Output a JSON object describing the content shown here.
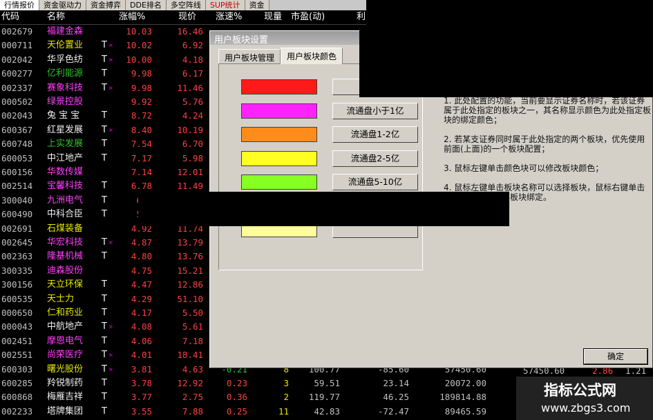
{
  "tabs": [
    {
      "label": "行情报价",
      "selected": true
    },
    {
      "label": "资金驱动力"
    },
    {
      "label": "资金搏弈"
    },
    {
      "label": "DDE排名"
    },
    {
      "label": "多空阵线"
    },
    {
      "label": "SUP统计",
      "red": true
    },
    {
      "label": "资金"
    }
  ],
  "header": {
    "code": "代码",
    "name": "名称",
    "chg": "涨幅%",
    "price": "现价",
    "speed": "涨速%",
    "vol": "现量",
    "pe": "市盈(动)",
    "more": "利"
  },
  "colors": {
    "name_yellow": "#e8e800",
    "name_magenta": "#ff40ff",
    "name_green": "#30c030",
    "name_white": "#f0f0f0",
    "up_red": "#ff4040",
    "down_green": "#30c030"
  },
  "rows": [
    {
      "code": "002679",
      "name": "福建金森",
      "t": "",
      "star": "",
      "chg": "10.03",
      "price": "16.46",
      "nc": "magenta"
    },
    {
      "code": "000711",
      "name": "天伦置业",
      "t": "T",
      "star": "×",
      "chg": "10.02",
      "price": "6.92",
      "nc": "yellow"
    },
    {
      "code": "002042",
      "name": "华孚色纺",
      "t": "T",
      "star": "×",
      "chg": "10.00",
      "price": "4.18",
      "nc": "white"
    },
    {
      "code": "600277",
      "name": "亿利能源",
      "t": "T",
      "star": "",
      "chg": "9.98",
      "price": "6.17",
      "nc": "green"
    },
    {
      "code": "002337",
      "name": "赛象科技",
      "t": "T",
      "star": "×",
      "chg": "9.98",
      "price": "11.46",
      "nc": "magenta"
    },
    {
      "code": "000502",
      "name": "绿景控股",
      "t": "",
      "star": "",
      "chg": "9.92",
      "price": "5.76",
      "nc": "magenta"
    },
    {
      "code": "002043",
      "name": "兔 宝 宝",
      "t": "T",
      "star": "",
      "chg": "8.72",
      "price": "4.24",
      "nc": "white"
    },
    {
      "code": "600367",
      "name": "红星发展",
      "t": "T",
      "star": "×",
      "chg": "8.40",
      "price": "10.19",
      "nc": "white"
    },
    {
      "code": "600748",
      "name": "上实发展",
      "t": "T",
      "star": "",
      "chg": "7.54",
      "price": "6.70",
      "nc": "green"
    },
    {
      "code": "600053",
      "name": "中江地产",
      "t": "T",
      "star": "",
      "chg": "7.17",
      "price": "5.98",
      "nc": "white"
    },
    {
      "code": "600156",
      "name": "华数传媒",
      "t": "",
      "star": "",
      "chg": "7.14",
      "price": "12.01",
      "nc": "magenta"
    },
    {
      "code": "002514",
      "name": "宝馨科技",
      "t": "T",
      "star": "",
      "chg": "6.78",
      "price": "11.49",
      "nc": "magenta"
    },
    {
      "code": "300040",
      "name": "九洲电气",
      "t": "T",
      "star": "",
      "chg": "6.2",
      "price": "",
      "nc": "magenta"
    },
    {
      "code": "600490",
      "name": "中科合臣",
      "t": "T",
      "star": "",
      "chg": "5.8",
      "price": "",
      "nc": "white"
    },
    {
      "code": "002691",
      "name": "石煤装备",
      "t": "",
      "star": "",
      "chg": "4.92",
      "price": "11.74",
      "nc": "yellow"
    },
    {
      "code": "002645",
      "name": "华宏科技",
      "t": "T",
      "star": "×",
      "chg": "4.87",
      "price": "13.79",
      "nc": "magenta"
    },
    {
      "code": "002363",
      "name": "隆基机械",
      "t": "T",
      "star": "",
      "chg": "4.80",
      "price": "13.76",
      "nc": "magenta"
    },
    {
      "code": "300335",
      "name": "迪森股份",
      "t": "",
      "star": "",
      "chg": "4.75",
      "price": "15.21",
      "nc": "magenta"
    },
    {
      "code": "300156",
      "name": "天立环保",
      "t": "T",
      "star": "",
      "chg": "4.47",
      "price": "12.86",
      "nc": "yellow"
    },
    {
      "code": "600535",
      "name": "天士力",
      "t": "T",
      "star": "",
      "chg": "4.29",
      "price": "51.10",
      "nc": "yellow"
    },
    {
      "code": "000650",
      "name": "仁和药业",
      "t": "T",
      "star": "",
      "chg": "4.17",
      "price": "5.50",
      "nc": "yellow"
    },
    {
      "code": "000043",
      "name": "中航地产",
      "t": "T",
      "star": "×",
      "chg": "4.08",
      "price": "5.61",
      "nc": "white"
    },
    {
      "code": "002451",
      "name": "摩恩电气",
      "t": "T",
      "star": "",
      "chg": "4.06",
      "price": "7.18",
      "nc": "magenta"
    },
    {
      "code": "002551",
      "name": "尚荣医疗",
      "t": "T",
      "star": "×",
      "chg": "4.01",
      "price": "18.41",
      "nc": "magenta"
    },
    {
      "code": "600303",
      "name": "曙光股份",
      "t": "T",
      "star": "×",
      "chg": "3.81",
      "price": "4.63",
      "speed": "-0.21",
      "vol": "8",
      "pe": "100.77",
      "f1": "-85.60",
      "f2": "57450.60",
      "nc": "yellow"
    },
    {
      "code": "600285",
      "name": "羚锐制药",
      "t": "T",
      "star": "",
      "chg": "3.78",
      "price": "12.92",
      "speed": "0.23",
      "vol": "3",
      "pe": "59.51",
      "f1": "23.14",
      "f2": "20072.00",
      "nc": "white"
    },
    {
      "code": "600868",
      "name": "梅雁吉祥",
      "t": "T",
      "star": "",
      "chg": "3.77",
      "price": "2.75",
      "speed": "0.36",
      "vol": "2",
      "pe": "119.77",
      "f1": "46.25",
      "f2": "189814.88",
      "nc": "white"
    },
    {
      "code": "002233",
      "name": "塔牌集团",
      "t": "T",
      "star": "",
      "chg": "3.55",
      "price": "7.88",
      "speed": "0.25",
      "vol": "11",
      "pe": "42.83",
      "f1": "-72.47",
      "f2": "89465.59",
      "nc": "white"
    }
  ],
  "dialog": {
    "title": "用户板块设置",
    "tabs": [
      "用户板块管理",
      "用户板块颜色"
    ],
    "colors": [
      {
        "swatch": "#ff1a1a",
        "label": "自选"
      },
      {
        "swatch": "#ff22ff",
        "label": "流通盘小于1亿"
      },
      {
        "swatch": "#ff8c1a",
        "label": "流通盘1-2亿"
      },
      {
        "swatch": "#ffff22",
        "label": "流通盘2-5亿"
      },
      {
        "swatch": "#88ff22",
        "label": "流通盘5-10亿"
      },
      {
        "swatch": "#ffffff",
        "label": ""
      },
      {
        "swatch": "#ffff99",
        "label": ""
      }
    ],
    "help": [
      "1. 此处配置的功能，当前要显示证券名称时，若该证券属于此处指定的板块之一，其名称显示颜色为此处指定板块的绑定颜色；",
      "2. 若某支证券同时属于此处指定的两个板块，优先使用前面(上面)的一个板块配置；",
      "3. 鼠标左键单击颜色块可以修改板块颜色；",
      "4. 鼠标左键单击板块名称可以选择板块，鼠标右键单击板块名称可以取消板块绑定。"
    ],
    "ok_label": "确定",
    "extra_row": {
      "col1": "57450.60",
      "col2": "2.86",
      "col3": "1.21"
    }
  },
  "watermark": {
    "line1": "指标公式网",
    "line2": "www.zbgs3.com"
  }
}
